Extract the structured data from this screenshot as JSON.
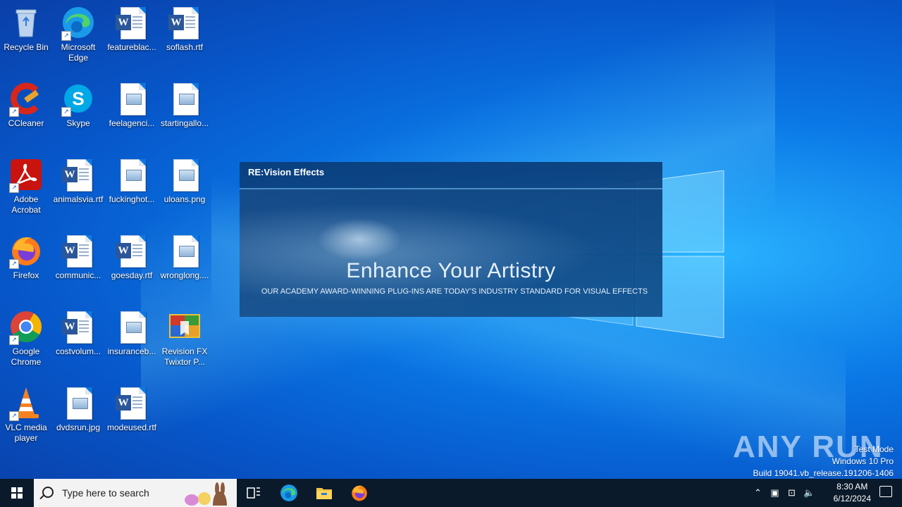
{
  "desktop": {
    "icons": [
      {
        "label": "Recycle Bin"
      },
      {
        "label": "Microsoft Edge"
      },
      {
        "label": "featureblac..."
      },
      {
        "label": "soflash.rtf"
      },
      {
        "label": "CCleaner"
      },
      {
        "label": "Skype"
      },
      {
        "label": "feelagenci..."
      },
      {
        "label": "startingallo..."
      },
      {
        "label": "Adobe Acrobat"
      },
      {
        "label": "animalsvia.rtf"
      },
      {
        "label": "fuckinghot..."
      },
      {
        "label": "uloans.png"
      },
      {
        "label": "Firefox"
      },
      {
        "label": "communic..."
      },
      {
        "label": "goesday.rtf"
      },
      {
        "label": "wronglong...."
      },
      {
        "label": "Google Chrome"
      },
      {
        "label": "costvolum..."
      },
      {
        "label": "insuranceb..."
      },
      {
        "label": "Revision FX Twixtor P..."
      },
      {
        "label": "VLC media player"
      },
      {
        "label": "dvdsrun.jpg"
      },
      {
        "label": "modeused.rtf"
      }
    ]
  },
  "splash": {
    "brand": "RE:Vision Effects",
    "headline": "Enhance Your Artistry",
    "tagline": "OUR ACADEMY AWARD-WINNING PLUG-INS ARE TODAY'S INDUSTRY STANDARD FOR VISUAL EFFECTS"
  },
  "watermark": {
    "logo": "ANY RUN",
    "line1": "Test Mode",
    "line2": "Windows 10 Pro",
    "line3": "Build 19041.vb_release.191206-1406"
  },
  "taskbar": {
    "search_placeholder": "Type here to search",
    "time": "8:30 AM",
    "date": "6/12/2024"
  }
}
